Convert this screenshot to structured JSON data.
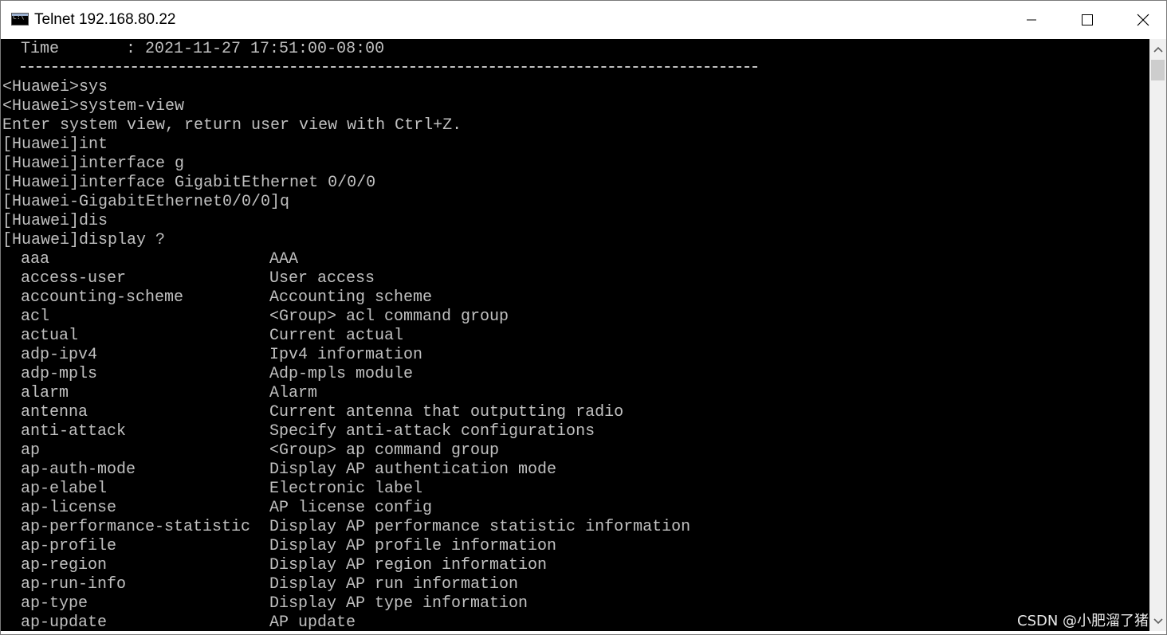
{
  "window": {
    "title": "Telnet 192.168.80.22",
    "controls": {
      "minimize": "minimize",
      "maximize": "maximize",
      "close": "close"
    }
  },
  "terminal": {
    "time_line": "Time       : 2021-11-27 17:51:00-08:00",
    "prompt_lines": [
      "<Huawei>sys",
      "<Huawei>system-view",
      "Enter system view, return user view with Ctrl+Z.",
      "[Huawei]int",
      "[Huawei]interface g",
      "[Huawei]interface GigabitEthernet 0/0/0",
      "[Huawei-GigabitEthernet0/0/0]q",
      "[Huawei]dis",
      "[Huawei]display ?"
    ],
    "help_rows": [
      {
        "cmd": "aaa",
        "desc": "AAA"
      },
      {
        "cmd": "access-user",
        "desc": "User access"
      },
      {
        "cmd": "accounting-scheme",
        "desc": "Accounting scheme"
      },
      {
        "cmd": "acl",
        "desc": "<Group> acl command group"
      },
      {
        "cmd": "actual",
        "desc": "Current actual"
      },
      {
        "cmd": "adp-ipv4",
        "desc": "Ipv4 information"
      },
      {
        "cmd": "adp-mpls",
        "desc": "Adp-mpls module"
      },
      {
        "cmd": "alarm",
        "desc": "Alarm"
      },
      {
        "cmd": "antenna",
        "desc": "Current antenna that outputting radio"
      },
      {
        "cmd": "anti-attack",
        "desc": "Specify anti-attack configurations"
      },
      {
        "cmd": "ap",
        "desc": "<Group> ap command group"
      },
      {
        "cmd": "ap-auth-mode",
        "desc": "Display AP authentication mode"
      },
      {
        "cmd": "ap-elabel",
        "desc": "Electronic label"
      },
      {
        "cmd": "ap-license",
        "desc": "AP license config"
      },
      {
        "cmd": "ap-performance-statistic",
        "desc": "Display AP performance statistic information"
      },
      {
        "cmd": "ap-profile",
        "desc": "Display AP profile information"
      },
      {
        "cmd": "ap-region",
        "desc": "Display AP region information"
      },
      {
        "cmd": "ap-run-info",
        "desc": "Display AP run information"
      },
      {
        "cmd": "ap-type",
        "desc": "Display AP type information"
      },
      {
        "cmd": "ap-update",
        "desc": "AP update"
      }
    ]
  },
  "watermark": "CSDN @小肥溜了猪",
  "colors": {
    "terminal_bg": "#000000",
    "terminal_fg": "#c0c0c0",
    "titlebar_bg": "#ffffff",
    "scrollbar_bg": "#f0f0f0"
  }
}
